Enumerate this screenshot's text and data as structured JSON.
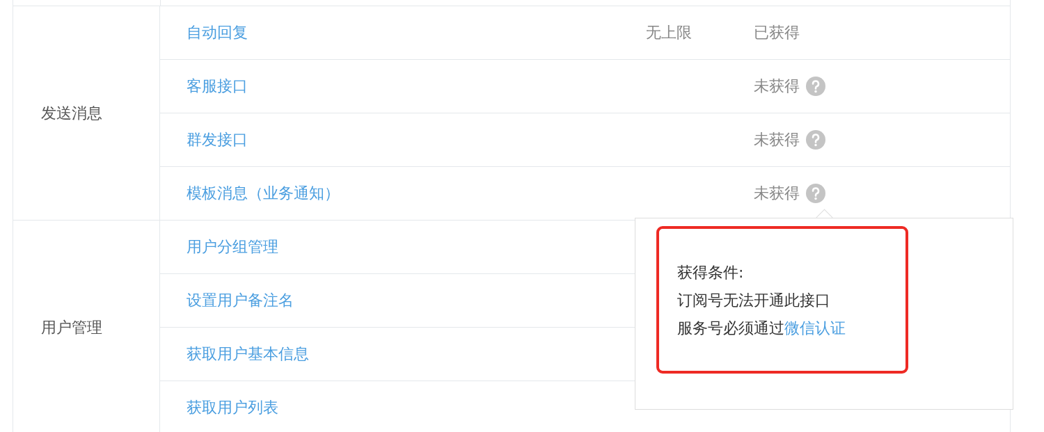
{
  "groups": [
    {
      "label": "发送消息",
      "items": [
        {
          "name": "自动回复",
          "quota": "无上限",
          "status": "已获得",
          "help": false
        },
        {
          "name": "客服接口",
          "status": "未获得",
          "help": true
        },
        {
          "name": "群发接口",
          "status": "未获得",
          "help": true
        },
        {
          "name": "模板消息（业务通知）",
          "status": "未获得",
          "help": true
        }
      ]
    },
    {
      "label": "用户管理",
      "items": [
        {
          "name": "用户分组管理"
        },
        {
          "name": "设置用户备注名"
        },
        {
          "name": "获取用户基本信息"
        },
        {
          "name": "获取用户列表"
        }
      ]
    }
  ],
  "popover": {
    "title": "获得条件:",
    "lines": [
      {
        "text": "订阅号无法开通此接口"
      },
      {
        "text": "服务号必须通过",
        "link": "微信认证"
      }
    ]
  }
}
